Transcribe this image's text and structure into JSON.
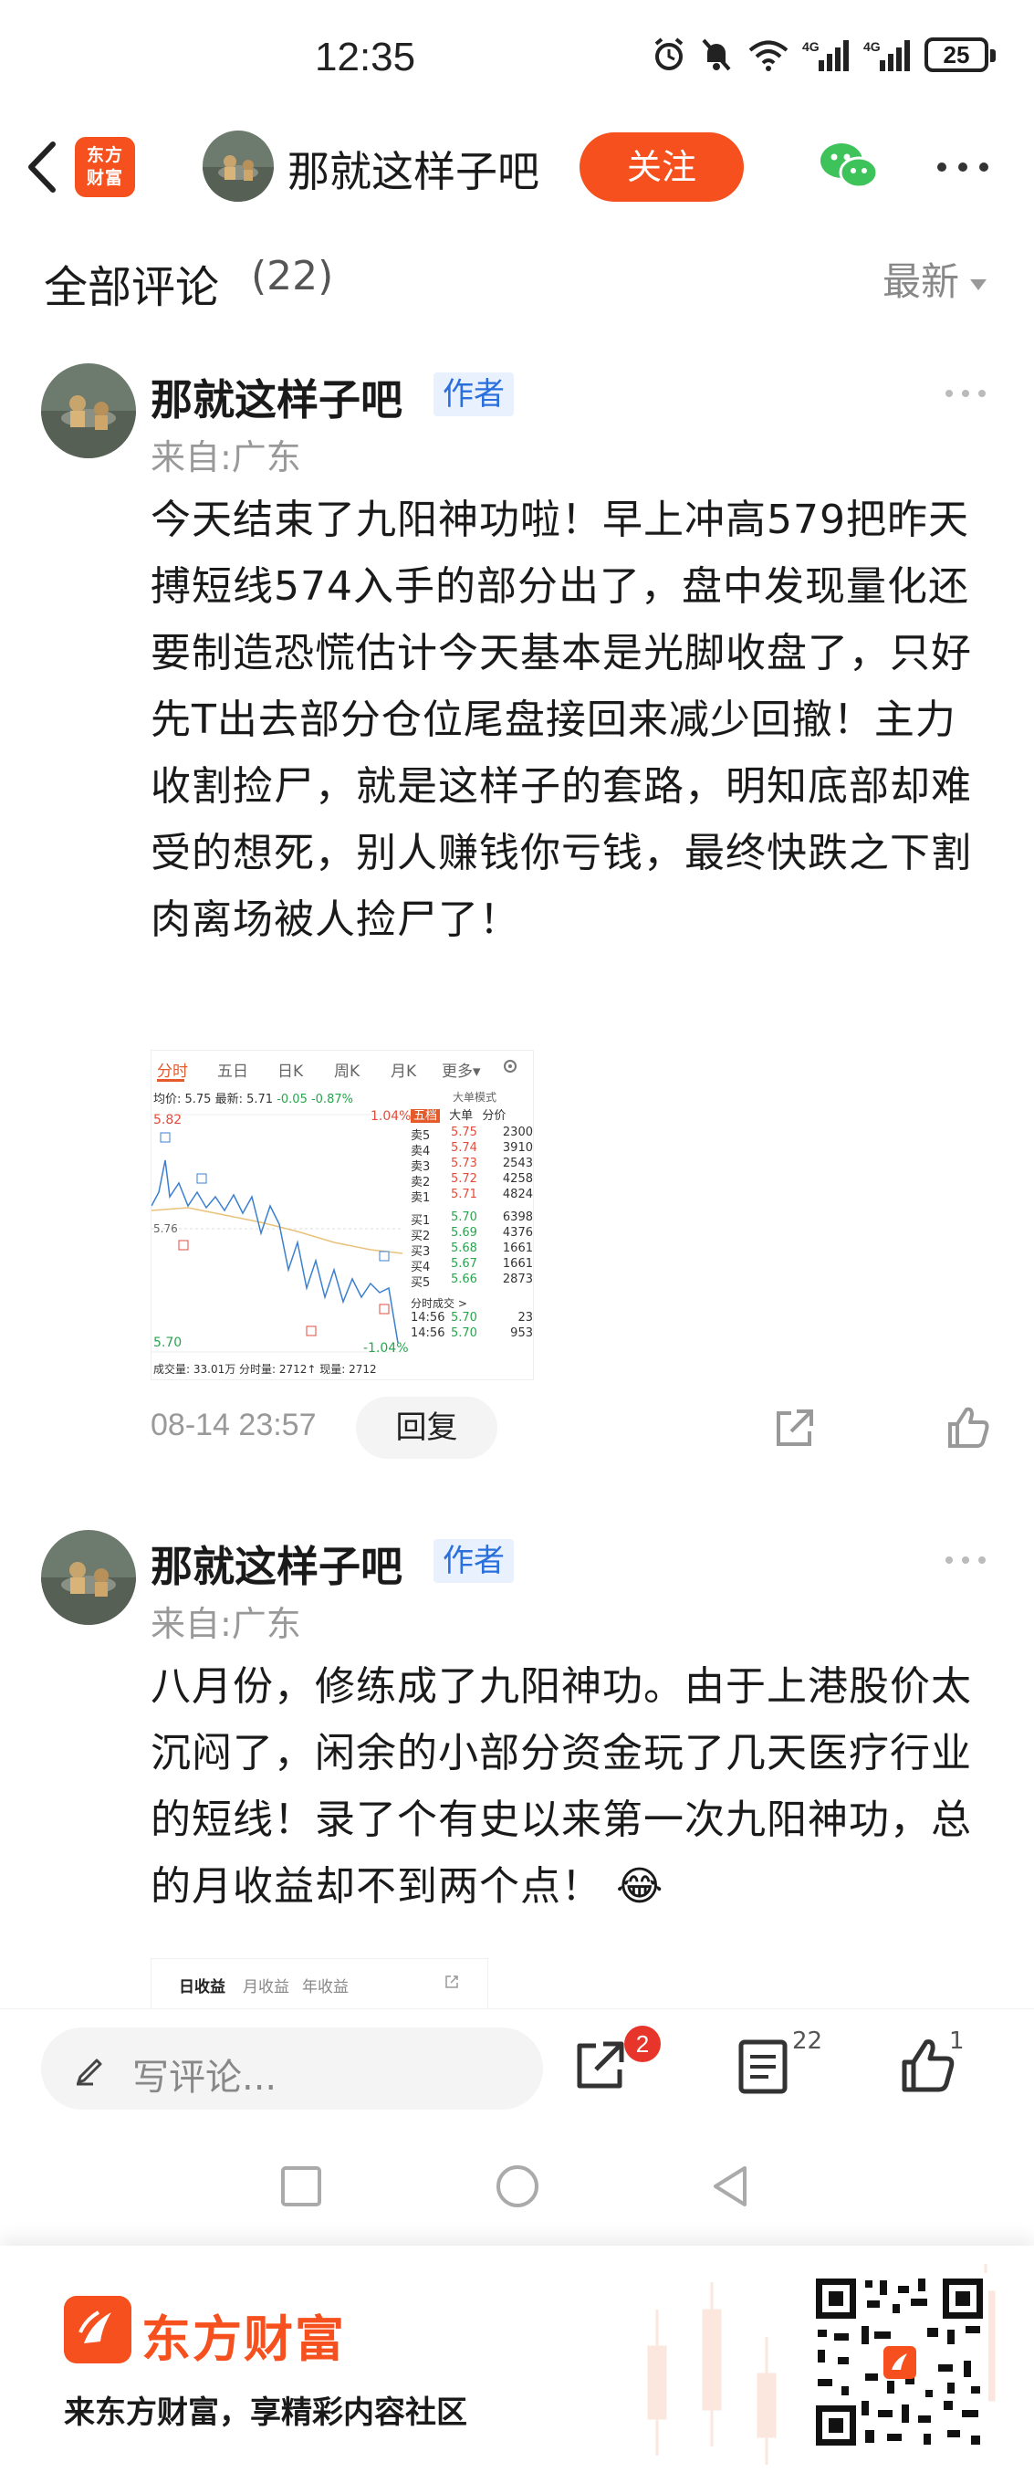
{
  "status_bar": {
    "time": "12:35",
    "battery": "25",
    "icons": [
      "alarm-icon",
      "mute-icon",
      "wifi-icon",
      "signal-4g-icon",
      "signal-4g-icon",
      "battery-icon"
    ]
  },
  "nav": {
    "logo_line1": "东方",
    "logo_line2": "财富",
    "author_name": "那就这样子吧",
    "follow_label": "关注",
    "icons": [
      "back-icon",
      "wechat-icon",
      "more-icon"
    ]
  },
  "comments_header": {
    "title": "全部评论",
    "count": "(22)",
    "sort_label": "最新"
  },
  "comments": [
    {
      "author": "那就这样子吧",
      "badge": "作者",
      "location": "来自:广东",
      "text": "今天结束了九阳神功啦！早上冲高579把昨天搏短线574入手的部分出了，盘中发现量化还要制造恐慌估计今天基本是光脚收盘了，只好先T出去部分仓位尾盘接回来减少回撤！主力收割捡尸，就是这样子的套路，明知底部却难受的想死，别人赚钱你亏钱，最终快跌之下割肉离场被人捡尸了！",
      "time": "08-14 23:57",
      "reply_label": "回复"
    },
    {
      "author": "那就这样子吧",
      "badge": "作者",
      "location": "来自:广东",
      "text": "八月份，修练成了九阳神功。由于上港股价太沉闷了，闲余的小部分资金玩了几天医疗行业的短线！录了个有史以来第一次九阳神功，总的月收益却不到两个点！",
      "emoji": "😂"
    }
  ],
  "stock_image": {
    "tabs": [
      "分时",
      "五日",
      "日K",
      "周K",
      "月K",
      "更多▾"
    ],
    "quote_prefix": "均价: 5.75 最新: 5.71",
    "quote_change": "-0.05 -0.87%",
    "mode": "大单模式",
    "price_high": "5.82",
    "price_mid": "5.76",
    "price_low": "5.70",
    "pct_high": "1.04%",
    "pct_low": "-1.04%",
    "footer": "成交量: 33.01万   分时量: 2712↑   现量: 2712",
    "book_head": [
      "五档",
      "大单",
      "分价"
    ],
    "asks": [
      {
        "label": "卖5",
        "price": "5.75",
        "vol": "2300"
      },
      {
        "label": "卖4",
        "price": "5.74",
        "vol": "3910"
      },
      {
        "label": "卖3",
        "price": "5.73",
        "vol": "2543"
      },
      {
        "label": "卖2",
        "price": "5.72",
        "vol": "4258"
      },
      {
        "label": "卖1",
        "price": "5.71",
        "vol": "4824"
      }
    ],
    "bids": [
      {
        "label": "买1",
        "price": "5.70",
        "vol": "6398"
      },
      {
        "label": "买2",
        "price": "5.69",
        "vol": "4376"
      },
      {
        "label": "买3",
        "price": "5.68",
        "vol": "1661"
      },
      {
        "label": "买4",
        "price": "5.67",
        "vol": "1661"
      },
      {
        "label": "买5",
        "price": "5.66",
        "vol": "2873"
      }
    ],
    "ticks_label": "分时成交 >",
    "ticks": [
      {
        "time": "14:56",
        "price": "5.70",
        "vol": "23"
      },
      {
        "time": "14:56",
        "price": "5.70",
        "vol": "953"
      }
    ]
  },
  "image2_tabs": [
    "日收益",
    "月收益",
    "年收益"
  ],
  "bottom_bar": {
    "placeholder": "写评论...",
    "share_badge": "2",
    "comments_count": "22",
    "likes_count": "1"
  },
  "promo": {
    "brand": "东方财富",
    "slogan": "来东方财富，享精彩内容社区"
  },
  "colors": {
    "accent": "#f5501e",
    "badge_bg": "#e8f1fd",
    "badge_text": "#2a6fdc",
    "up": "#e24c3c",
    "down": "#2aa44f"
  }
}
